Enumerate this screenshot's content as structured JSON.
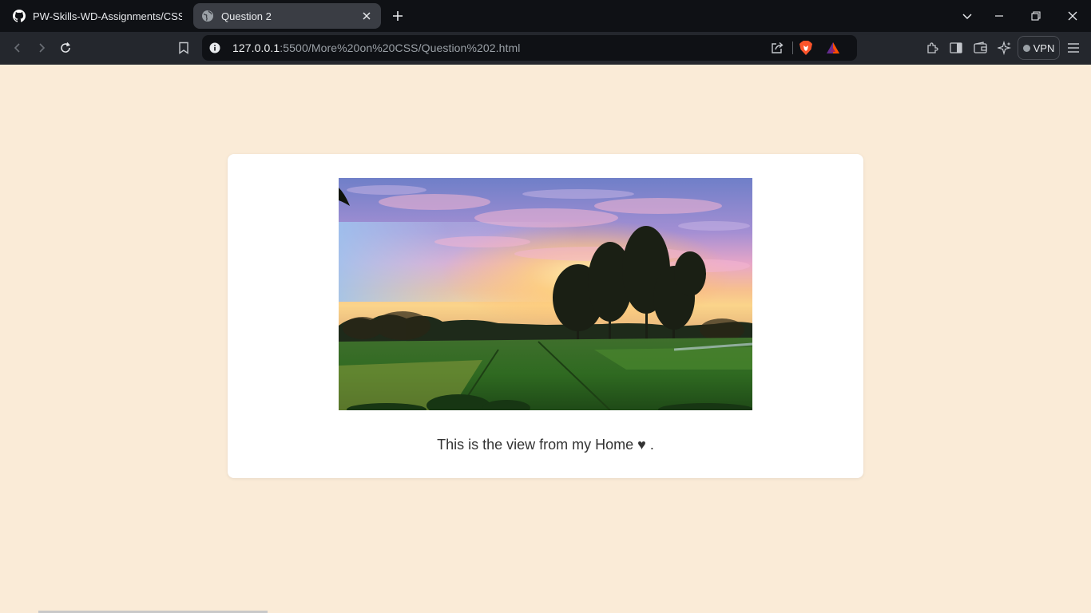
{
  "browser": {
    "tabs": [
      {
        "title": "PW-Skills-WD-Assignments/CSS/More",
        "icon": "github-icon",
        "active": false
      },
      {
        "title": "Question 2",
        "icon": "globe-icon",
        "active": true
      }
    ],
    "address_bar": {
      "host": "127.0.0.1",
      "path": ":5500/More%20on%20CSS/Question%202.html"
    },
    "vpn_label": "VPN"
  },
  "page": {
    "background_color": "#faebd7",
    "card_color": "#ffffff",
    "image": {
      "alt": "Sunset over green paddy fields with trees"
    },
    "caption": "This is the view from my Home ♥ ."
  }
}
